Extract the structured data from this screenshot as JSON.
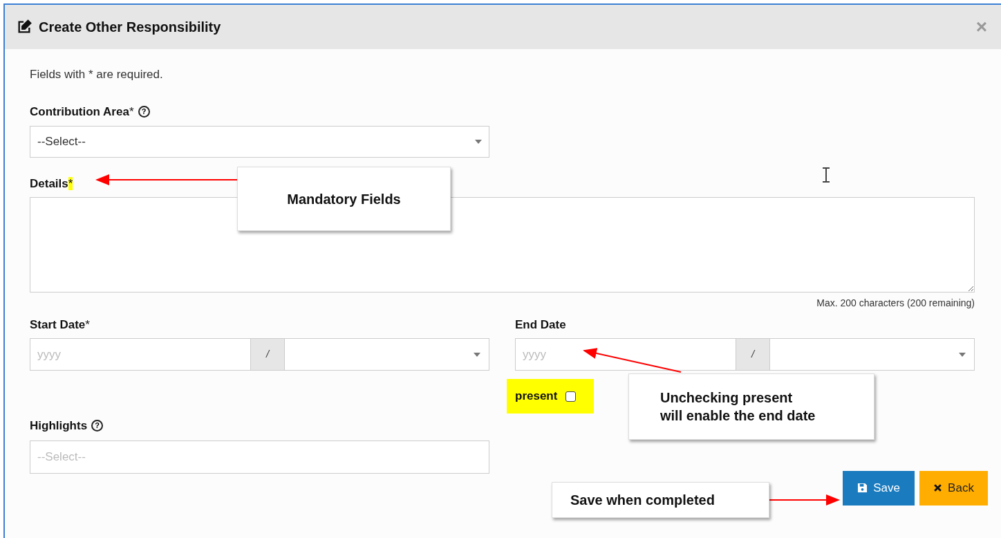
{
  "dialog": {
    "title": "Create Other Responsibility",
    "close": "×"
  },
  "note": "Fields with * are required.",
  "contribution_area": {
    "label": "Contribution Area",
    "mark": "*",
    "help": "?",
    "placeholder": "--Select--"
  },
  "details": {
    "label": "Details",
    "mark": "*",
    "mark_highlighted": true,
    "counter": "Max. 200 characters (200 remaining)"
  },
  "start_date": {
    "label": "Start Date",
    "mark": "*",
    "year_placeholder": "yyyy",
    "separator": "/"
  },
  "end_date": {
    "label": "End Date",
    "year_placeholder": "yyyy",
    "separator": "/"
  },
  "present": {
    "label": "present",
    "checked": false,
    "highlighted": true
  },
  "highlights": {
    "label": "Highlights",
    "help": "?",
    "placeholder": "--Select--"
  },
  "buttons": [
    {
      "label": "Save",
      "kind": "save"
    },
    {
      "label": "Back",
      "kind": "back"
    }
  ],
  "callouts": [
    {
      "text": "Mandatory Fields"
    },
    {
      "text": "Unchecking present\nwill enable the end date"
    },
    {
      "text": "Save when completed"
    }
  ]
}
